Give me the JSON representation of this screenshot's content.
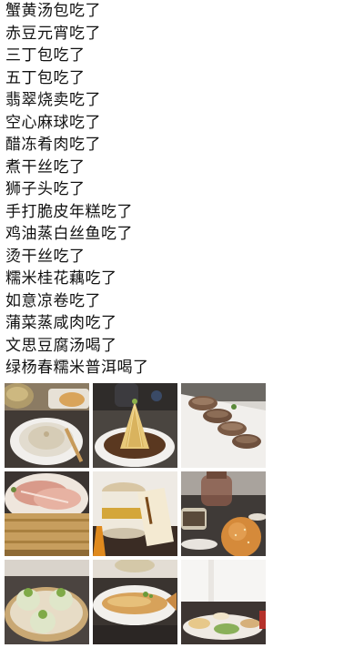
{
  "post": {
    "lines": [
      "蟹黄汤包吃了",
      "赤豆元宵吃了",
      "三丁包吃了",
      "五丁包吃了",
      "翡翠烧卖吃了",
      "空心麻球吃了",
      "醋冻肴肉吃了",
      "煮干丝吃了",
      "狮子头吃了",
      "手打脆皮年糕吃了",
      "鸡油蒸白丝鱼吃了",
      "烫干丝吃了",
      "糯米桂花藕吃了",
      "如意凉卷吃了",
      "蒲菜蒸咸肉吃了",
      "文思豆腐汤喝了",
      "绿杨春糯米普洱喝了"
    ]
  },
  "photos": [
    {
      "subject": "soup-dumpling-photo"
    },
    {
      "subject": "shredded-tofu-tower-photo"
    },
    {
      "subject": "rice-cake-photo"
    },
    {
      "subject": "cured-pork-steamer-photo"
    },
    {
      "subject": "tea-tin-photo"
    },
    {
      "subject": "sesame-ball-teapot-photo"
    },
    {
      "subject": "jade-shaomai-photo"
    },
    {
      "subject": "steamed-fish-photo"
    },
    {
      "subject": "table-spread-photo"
    }
  ],
  "colors": {
    "text": "#111111",
    "background": "#ffffff"
  }
}
